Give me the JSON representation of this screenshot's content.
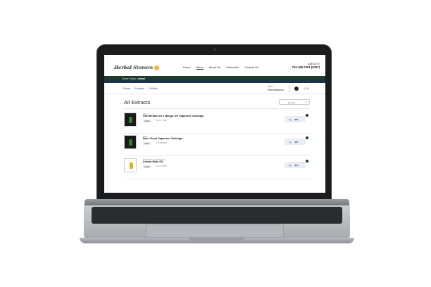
{
  "header": {
    "logo": "Herbal Stoners",
    "nav": [
      "Home",
      "Menu",
      "About Us",
      "Subscribe",
      "Contact Us"
    ],
    "active_nav": "Menu",
    "call_label": "Call Us ✆",
    "phone": "734-458-7401 (6337)"
  },
  "breadcrumb": {
    "path": "Home / menu /",
    "current": "extract"
  },
  "subnav": {
    "links": [
      "Flower",
      "Extracts",
      "Edibles"
    ],
    "menu_label": "MENU",
    "menu_value": "Recreational",
    "cart_count": "0"
  },
  "main": {
    "title": "All Extracts",
    "sort_label": "No Sort",
    "products": [
      {
        "brand": "Ozzi",
        "name": "Ooh'Bn'Ban #4 x Mango OG Vaporizer Cartridge",
        "type": "Hybrid",
        "thc": "THC: 47.79%",
        "price_prefix": "1g",
        "price": "$50"
      },
      {
        "brand": "OZZI",
        "name": "Rare Cloud Vaporizer Cartridge",
        "type": "Sativa",
        "thc": "THC: 86.88%",
        "price_prefix": "1g",
        "price": "$51"
      },
      {
        "brand": "Herbal Nau Cannabarinic",
        "name": "Lemon Haze Oil",
        "type": "Hybrid",
        "thc": "THC: 40.45%",
        "price_prefix": "1g",
        "price": "$15"
      }
    ]
  },
  "colors": {
    "brand_green": "#1d3a2c",
    "accent_blue": "#1b2f5c"
  }
}
